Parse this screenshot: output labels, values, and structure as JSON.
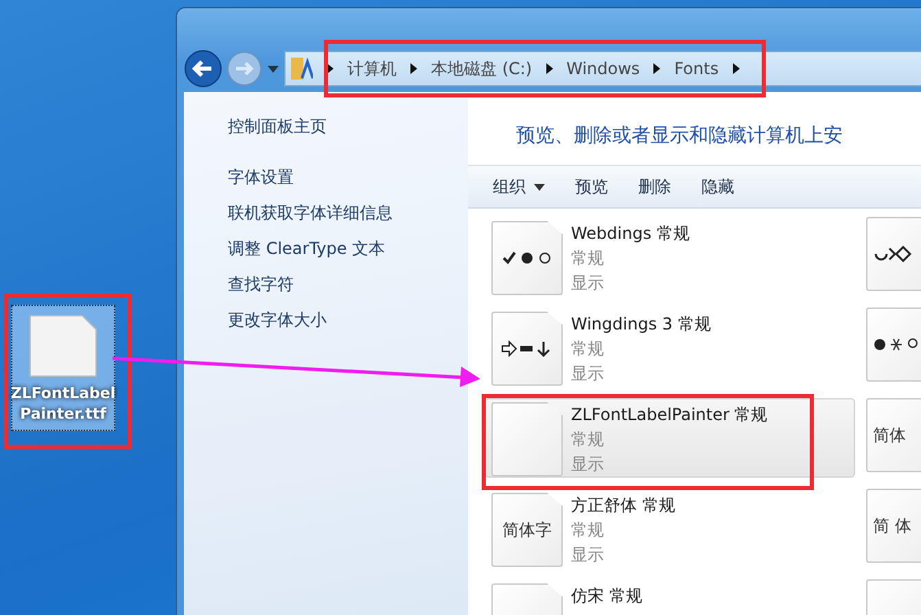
{
  "desktop_file": {
    "label_lines": [
      "ZLFontLabel",
      "Painter.ttf"
    ],
    "selected": true
  },
  "window": {
    "address": {
      "crumbs": [
        "计算机",
        "本地磁盘 (C:)",
        "Windows",
        "Fonts"
      ]
    },
    "sidebar": {
      "home": "控制面板主页",
      "links": [
        "字体设置",
        "联机获取字体详细信息",
        "调整 ClearType 文本",
        "查找字符",
        "更改字体大小"
      ]
    },
    "header": "预览、删除或者显示和隐藏计算机上安",
    "toolbar": [
      {
        "label": "组织",
        "dropdown": true
      },
      {
        "label": "预览",
        "dropdown": false
      },
      {
        "label": "删除",
        "dropdown": false
      },
      {
        "label": "隐藏",
        "dropdown": false
      }
    ],
    "fonts": [
      {
        "name": "Webdings 常规",
        "style": "常规",
        "status": "显示",
        "selected": false,
        "preview": {
          "kind": "symbols"
        },
        "side_preview": {
          "kind": "signs"
        }
      },
      {
        "name": "Wingdings 3 常规",
        "style": "常规",
        "status": "显示",
        "selected": false,
        "preview": {
          "kind": "arrows"
        },
        "side_preview": {
          "kind": "flowers"
        }
      },
      {
        "name": "ZLFontLabelPainter 常规",
        "style": "常规",
        "status": "显示",
        "selected": true,
        "side_preview": {
          "kind": "text",
          "text": "简体"
        }
      },
      {
        "name": "方正舒体 常规",
        "style": "常规",
        "status": "显示",
        "selected": false,
        "preview": {
          "kind": "text",
          "text": "简体字"
        },
        "side_preview": {
          "kind": "text",
          "text": "简 体"
        }
      },
      {
        "name": "仿宋 常规",
        "selected": false
      }
    ]
  }
}
